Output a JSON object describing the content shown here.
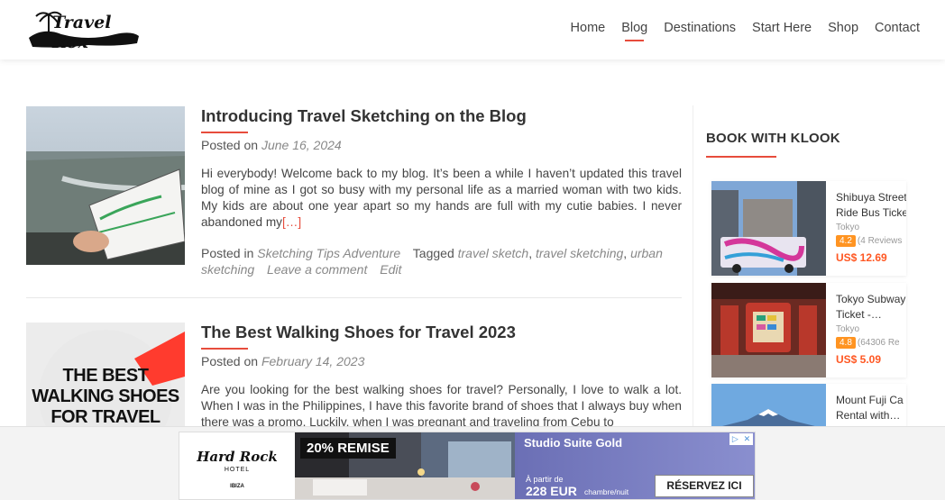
{
  "site": {
    "logo_text": "Travel Rox"
  },
  "nav": {
    "items": [
      {
        "label": "Home",
        "active": false
      },
      {
        "label": "Blog",
        "active": true
      },
      {
        "label": "Destinations",
        "active": false
      },
      {
        "label": "Start Here",
        "active": false
      },
      {
        "label": "Shop",
        "active": false
      },
      {
        "label": "Contact",
        "active": false
      }
    ]
  },
  "posts": [
    {
      "title": "Introducing Travel Sketching on the Blog",
      "posted_on_label": "Posted on",
      "date": "June 16, 2024",
      "excerpt": "Hi everybody! Welcome back to my blog. It’s been a while I haven’t updated this travel blog of mine as I got so busy with my personal life as a married woman with two kids. My kids are about one year apart so my hands are full with my cutie babies. I never abandoned my",
      "readmore": "[…]",
      "posted_in_label": "Posted in",
      "category": "Sketching Tips Adventure",
      "tagged_label": "Tagged",
      "tag1": "travel sketch",
      "tag2": "travel sketching",
      "tag3": "urban sketching",
      "comment_link": "Leave a comment",
      "edit_link": "Edit"
    },
    {
      "title": "The Best Walking Shoes for Travel 2023",
      "posted_on_label": "Posted on",
      "date": "February 14, 2023",
      "excerpt": "Are you looking for the best walking shoes for travel? Personally, I love to walk a lot. When I was in the Philippines, I have this favorite brand of shoes that I always buy when there was a promo. Luckily, when I was pregnant and traveling from Cebu to",
      "thumb_text": [
        "THE BEST",
        "WALKING SHOES",
        "FOR TRAVEL"
      ]
    }
  ],
  "sidebar": {
    "widget_title": "BOOK WITH KLOOK",
    "klook": [
      {
        "name_line1": "Shibuya Street",
        "name_line2": "Ride Bus Ticke",
        "city": "Tokyo",
        "rating": "4.2",
        "reviews": "(4 Reviews",
        "price": "US$ 12.69"
      },
      {
        "name_line1": "Tokyo Subway",
        "name_line2": "Ticket -…",
        "city": "Tokyo",
        "rating": "4.8",
        "reviews": "(64306 Re",
        "price": "US$ 5.09"
      },
      {
        "name_line1": "Mount Fuji Ca",
        "name_line2": "Rental with…"
      }
    ]
  },
  "ad": {
    "brand_line1": "Hard Rock",
    "brand_line2": "HOTEL",
    "brand_line3": "IBIZA",
    "promo": "20% REMISE",
    "room": "Studio Suite Gold",
    "from_label": "À partir de",
    "price": "228 EUR",
    "unit": "chambre/nuit",
    "cta": "RÉSERVEZ ICI"
  },
  "colors": {
    "accent": "#e74c3c",
    "klook_orange": "#ff5722",
    "rating": "#ff9422"
  }
}
